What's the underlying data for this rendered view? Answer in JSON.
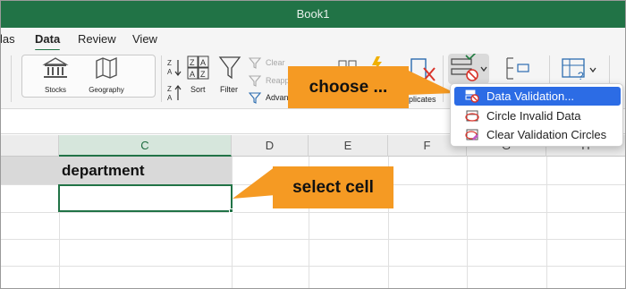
{
  "window": {
    "title": "Book1"
  },
  "ribbon_tabs": [
    {
      "label": "las"
    },
    {
      "label": "Data"
    },
    {
      "label": "Review"
    },
    {
      "label": "View"
    }
  ],
  "data_types": [
    {
      "label": "Stocks",
      "icon": "bank-icon"
    },
    {
      "label": "Geography",
      "icon": "map-icon"
    }
  ],
  "sort_filter": {
    "sort_label": "Sort",
    "filter_label": "Filter",
    "clear_label": "Clear",
    "reapply_label": "Reapp",
    "advanced_label": "Advan"
  },
  "data_tools": {
    "duplicates_label": "uplicates"
  },
  "columns": [
    "C",
    "D",
    "E",
    "F",
    "G",
    "H"
  ],
  "cells": {
    "c_header": "department"
  },
  "callouts": {
    "choose": "choose ...",
    "select_cell": "select cell"
  },
  "validation_menu": {
    "items": [
      {
        "label": "Data Validation...",
        "icon": "data-validation-icon",
        "highlighted": true
      },
      {
        "label": "Circle Invalid Data",
        "icon": "circle-invalid-icon",
        "highlighted": false
      },
      {
        "label": "Clear Validation Circles",
        "icon": "clear-circles-icon",
        "highlighted": false
      }
    ]
  },
  "colors": {
    "excel_green": "#217346",
    "callout_orange": "#f59a23",
    "menu_highlight": "#2c6ce5"
  }
}
